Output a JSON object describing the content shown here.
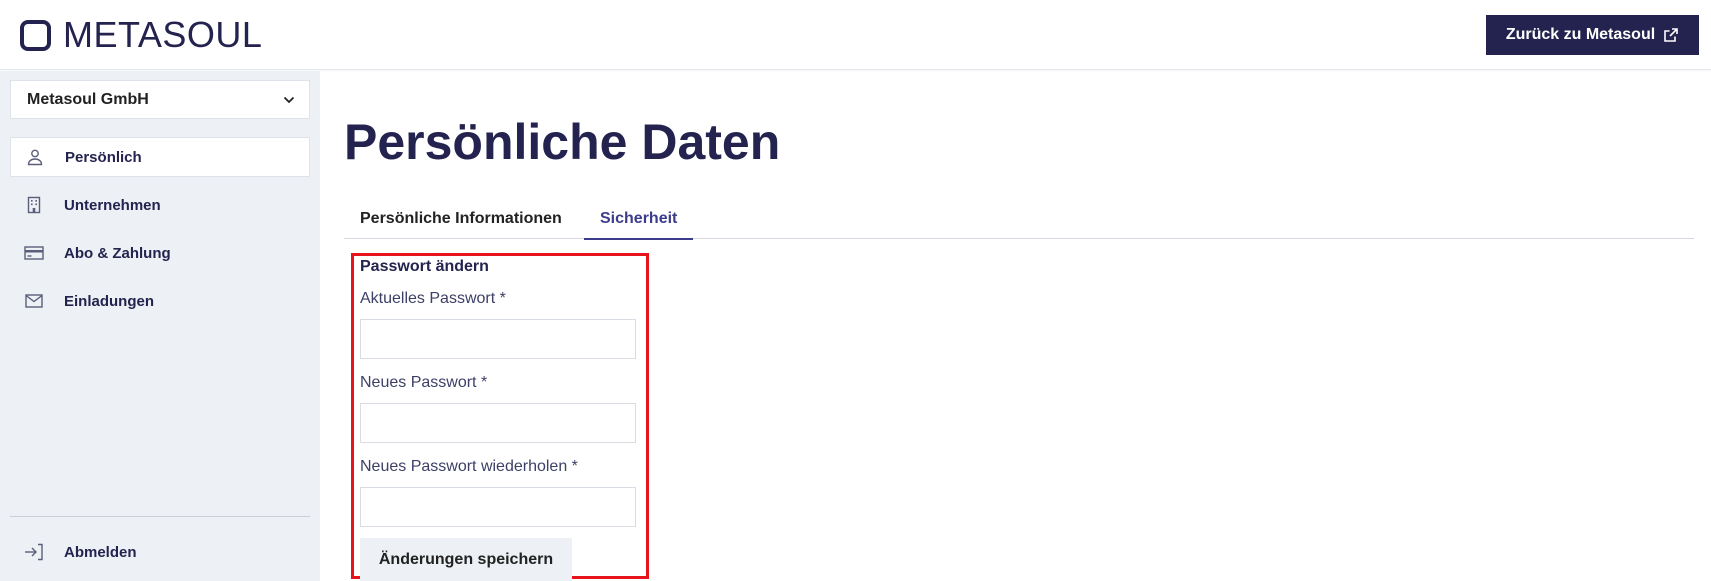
{
  "header": {
    "logo_text": "METASOUL",
    "back_button_label": "Zurück zu Metasoul",
    "back_button_icon": "external-link-icon"
  },
  "sidebar": {
    "company": "Metasoul GmbH",
    "company_chevron_icon": "chevron-down-icon",
    "items": [
      {
        "label": "Persönlich",
        "icon": "user-icon",
        "active": true
      },
      {
        "label": "Unternehmen",
        "icon": "building-icon",
        "active": false
      },
      {
        "label": "Abo & Zahlung",
        "icon": "credit-card-icon",
        "active": false
      },
      {
        "label": "Einladungen",
        "icon": "envelope-icon",
        "active": false
      }
    ],
    "logout_label": "Abmelden",
    "logout_icon": "logout-icon"
  },
  "main": {
    "title": "Persönliche Daten",
    "tabs": [
      {
        "label": "Persönliche Informationen",
        "active": false
      },
      {
        "label": "Sicherheit",
        "active": true
      }
    ],
    "section_title": "Passwort ändern",
    "fields": [
      {
        "label": "Aktuelles Passwort *",
        "value": "",
        "placeholder": ""
      },
      {
        "label": "Neues Passwort *",
        "value": "",
        "placeholder": ""
      },
      {
        "label": "Neues Passwort wiederholen *",
        "value": "",
        "placeholder": ""
      }
    ],
    "save_label": "Änderungen speichern"
  },
  "colors": {
    "primary": "#24234f",
    "accent_tab": "#3b3c8c",
    "sidebar_bg": "#edf0f5",
    "highlight": "#e8141c"
  }
}
